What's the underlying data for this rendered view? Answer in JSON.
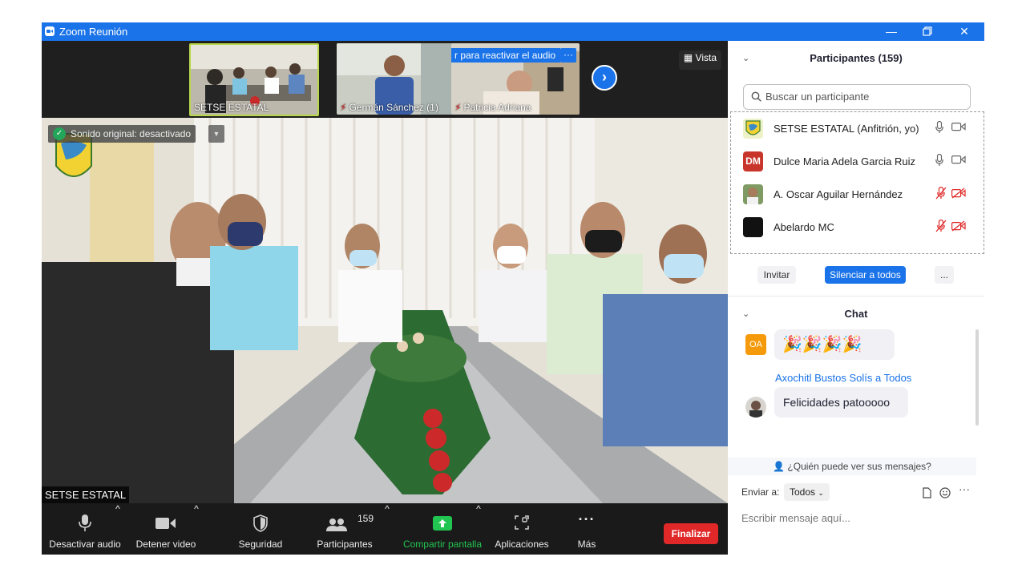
{
  "window": {
    "title": "Zoom Reunión"
  },
  "thumbnails": [
    {
      "name": "SETSE ESTATAL",
      "muted": false,
      "highlighted": true
    },
    {
      "name": "Germán Sánchez (1)",
      "muted": true,
      "highlighted": false
    },
    {
      "name": "Patricia Adriana",
      "muted": true,
      "highlighted": false,
      "banner": "r para reactivar el audio"
    }
  ],
  "view": {
    "label": "Vista"
  },
  "main_video": {
    "original_sound": "Sonido original: desactivado",
    "speaker_name": "SETSE ESTATAL"
  },
  "toolbar": {
    "mute_label": "Desactivar audio",
    "video_label": "Detener video",
    "security_label": "Seguridad",
    "participants_label": "Participantes",
    "participants_count": "159",
    "share_label": "Compartir pantalla",
    "apps_label": "Aplicaciones",
    "more_label": "Más",
    "end_label": "Finalizar"
  },
  "participants_panel": {
    "title": "Participantes (159)",
    "search_placeholder": "Buscar un participante",
    "participants": [
      {
        "name": "SETSE ESTATAL (Anfitrión, yo)",
        "initials": "",
        "avatar_color": "#cfd9a0",
        "muted": false,
        "video_off": false
      },
      {
        "name": "Dulce Maria Adela Garcia Ruiz",
        "initials": "DM",
        "avatar_color": "#c8352a",
        "muted": false,
        "video_off": false
      },
      {
        "name": "A. Oscar Aguilar Hernández",
        "initials": "",
        "avatar_color": "#6f8a5a",
        "muted": true,
        "video_off": true
      },
      {
        "name": "Abelardo MC",
        "initials": "",
        "avatar_color": "#111111",
        "muted": true,
        "video_off": true
      }
    ],
    "invite_label": "Invitar",
    "mute_all_label": "Silenciar a todos",
    "more_label": "..."
  },
  "chat_panel": {
    "title": "Chat",
    "messages": [
      {
        "sender_initials": "OA",
        "sender_color": "#f59a0a",
        "text": "🎉🎉🎉🎉"
      },
      {
        "sender_line": "Axochitl Bustos Solís a Todos",
        "text": "Felicidades patooooo"
      }
    ],
    "who_can_see": "¿Quién puede ver sus mensajes?",
    "send_to_label": "Enviar a:",
    "send_to_value": "Todos",
    "input_placeholder": "Escribir mensaje aquí..."
  },
  "colors": {
    "accent": "#1a73e8",
    "danger": "#e02828",
    "share_green": "#23c552",
    "window_bg": "#1a1a1a"
  }
}
